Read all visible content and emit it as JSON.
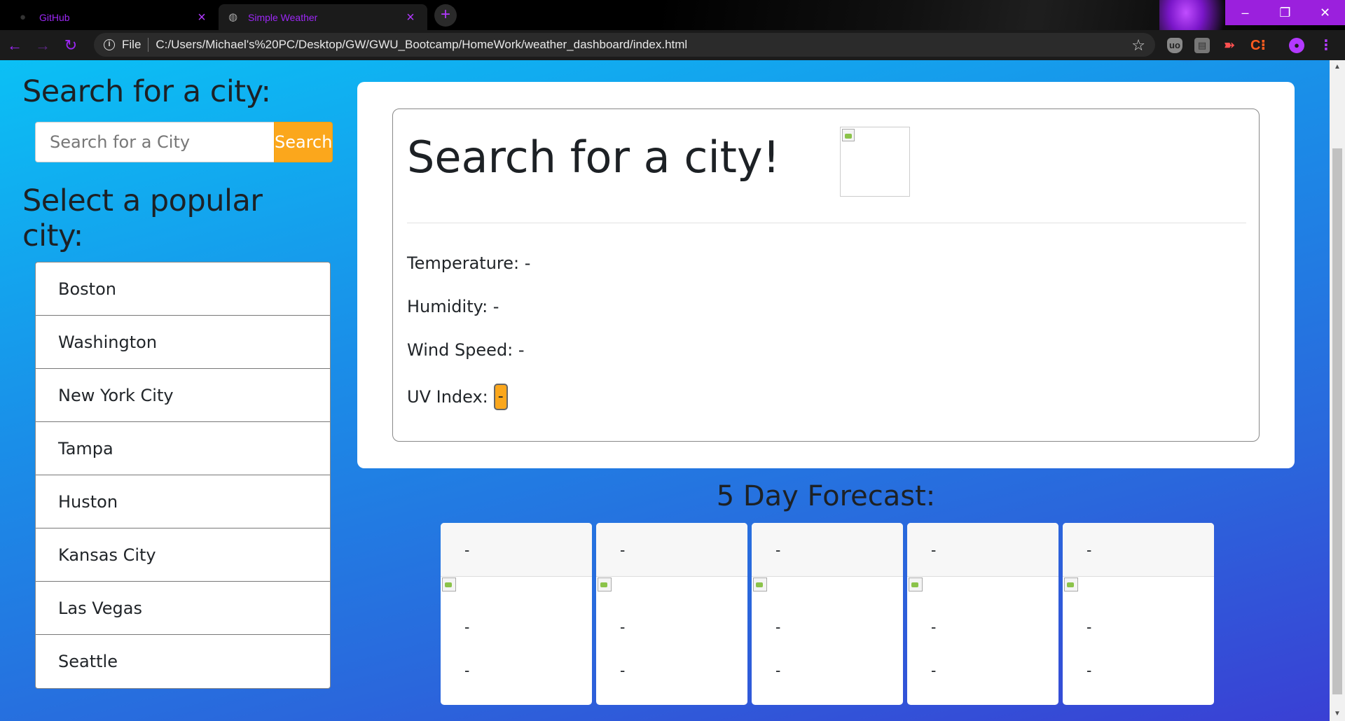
{
  "browser": {
    "tabs": [
      {
        "title": "GitHub",
        "active": false
      },
      {
        "title": "Simple Weather",
        "active": true
      }
    ],
    "file_label": "File",
    "url": "C:/Users/Michael's%20PC/Desktop/GW/GWU_Bootcamp/HomeWork/weather_dashboard/index.html",
    "accent_color": "#9c27f5"
  },
  "sidebar": {
    "search_heading": "Search for a city:",
    "search_placeholder": "Search for a City",
    "search_button": "Search",
    "popular_heading": "Select a popular city:",
    "cities": [
      "Boston",
      "Washington",
      "New York City",
      "Tampa",
      "Huston",
      "Kansas City",
      "Las Vegas",
      "Seattle"
    ]
  },
  "current": {
    "title": "Search for a city!",
    "temperature": "Temperature: -",
    "humidity": "Humidity: -",
    "wind": "Wind Speed: -",
    "uv_label": "UV Index:",
    "uv_value": "-"
  },
  "forecast": {
    "heading": "5 Day Forecast:",
    "days": [
      {
        "date": "-",
        "temp": "-",
        "humidity": "-"
      },
      {
        "date": "-",
        "temp": "-",
        "humidity": "-"
      },
      {
        "date": "-",
        "temp": "-",
        "humidity": "-"
      },
      {
        "date": "-",
        "temp": "-",
        "humidity": "-"
      },
      {
        "date": "-",
        "temp": "-",
        "humidity": "-"
      }
    ]
  },
  "colors": {
    "button_orange": "#fba71c",
    "gradient_top": "#0bc0f5",
    "gradient_bottom": "#3a3fd4"
  }
}
